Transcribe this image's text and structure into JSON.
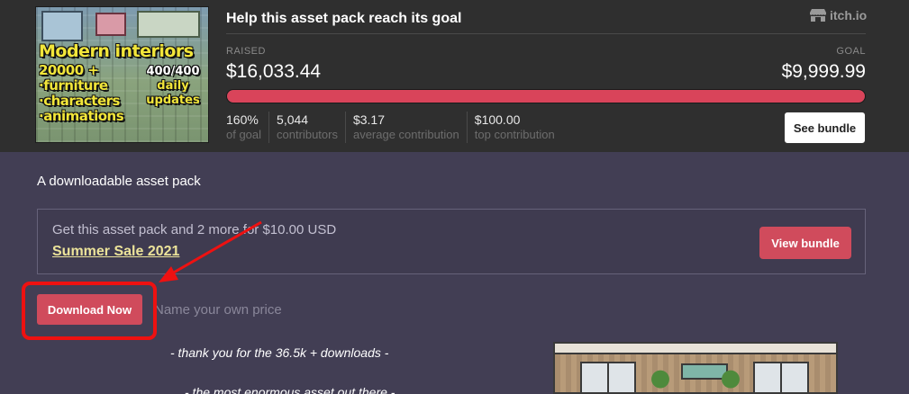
{
  "banner": {
    "title": "Help this asset pack reach its goal",
    "site_name": "itch.io",
    "raised_label": "RAISED",
    "goal_label": "GOAL",
    "raised_value": "$16,033.44",
    "goal_value": "$9,999.99",
    "progress_fraction": 1.0,
    "progress_color": "#d9445a",
    "stats": [
      {
        "value": "160%",
        "label": "of goal"
      },
      {
        "value": "5,044",
        "label": "contributors"
      },
      {
        "value": "$3.17",
        "label": "average contribution"
      },
      {
        "value": "$100.00",
        "label": "top contribution"
      }
    ],
    "see_bundle_label": "See bundle",
    "cover": {
      "title": "Modern interiors",
      "features": "20000 +\n·furniture\n·characters\n·animations",
      "counter": "400/400",
      "updates": "daily\nupdates"
    }
  },
  "page": {
    "pack_type": "A downloadable asset pack",
    "bundle_offer": {
      "description": "Get this asset pack and 2 more for $10.00 USD",
      "sale_name": "Summer Sale 2021",
      "button_label": "View bundle"
    },
    "download_label": "Download Now",
    "price_hint": "Name your own price",
    "description_lines": [
      "- thank you for the 36.5k + downloads -",
      "- the most enormous asset out there -"
    ]
  },
  "colors": {
    "accent": "#d04b5c",
    "annotation": "#ee1111",
    "page_bg": "#423e54",
    "banner_bg": "#2f2f2f"
  }
}
